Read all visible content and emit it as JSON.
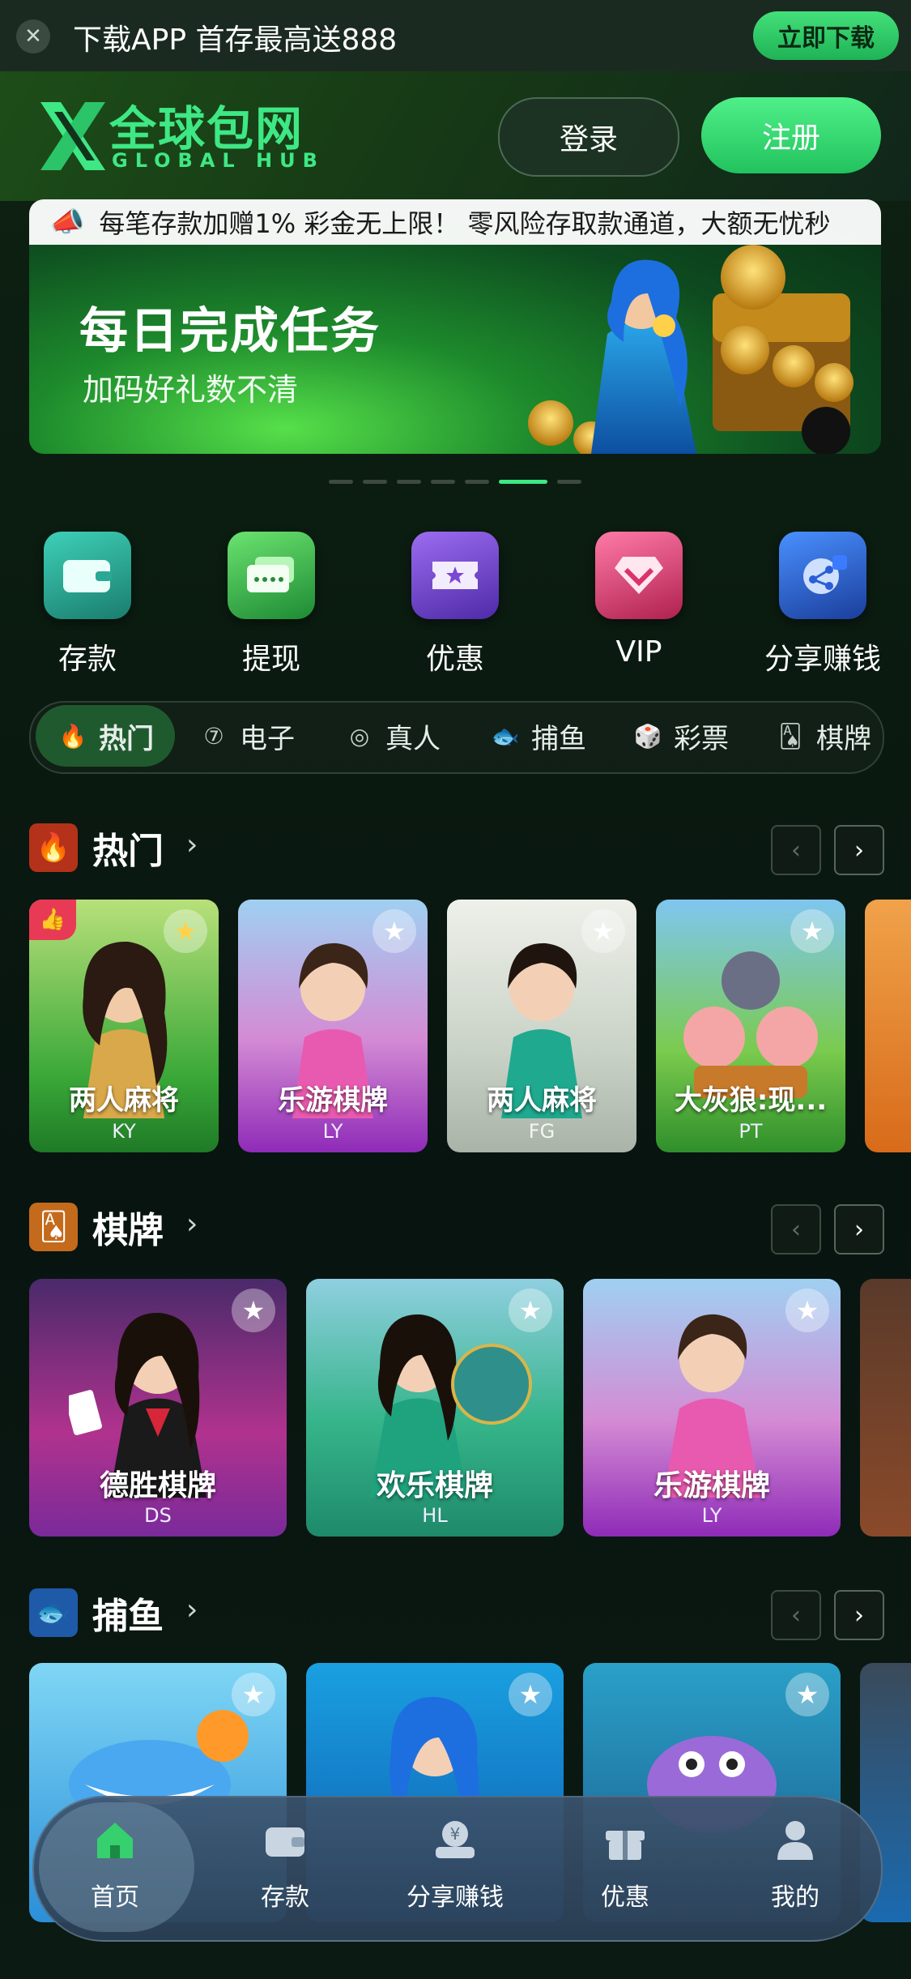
{
  "download_bar": {
    "text": "下载APP 首存最高送888",
    "button": "立即下载"
  },
  "header": {
    "logo_cn": "全球包网",
    "logo_en": "GLOBAL HUB",
    "login": "登录",
    "register": "注册"
  },
  "banner": {
    "marquee": "每笔存款加赠1% 彩金无上限！ 零风险存取款通道，大额无忧秒",
    "title": "每日完成任务",
    "subtitle": "加码好礼数不清"
  },
  "quick_links": [
    "存款",
    "提现",
    "优惠",
    "VIP",
    "分享赚钱"
  ],
  "categories": [
    "热门",
    "电子",
    "真人",
    "捕鱼",
    "彩票",
    "棋牌"
  ],
  "sections": {
    "hot": {
      "title": "热门",
      "games": [
        {
          "name": "两人麻将",
          "provider": "KY"
        },
        {
          "name": "乐游棋牌",
          "provider": "LY"
        },
        {
          "name": "两人麻将",
          "provider": "FG"
        },
        {
          "name": "大灰狼:现...",
          "provider": "PT"
        }
      ]
    },
    "cards": {
      "title": "棋牌",
      "games": [
        {
          "name": "德胜棋牌",
          "provider": "DS"
        },
        {
          "name": "欢乐棋牌",
          "provider": "HL"
        },
        {
          "name": "乐游棋牌",
          "provider": "LY"
        }
      ]
    },
    "fishing": {
      "title": "捕鱼"
    }
  },
  "bottom_nav": [
    "首页",
    "存款",
    "分享赚钱",
    "优惠",
    "我的"
  ]
}
